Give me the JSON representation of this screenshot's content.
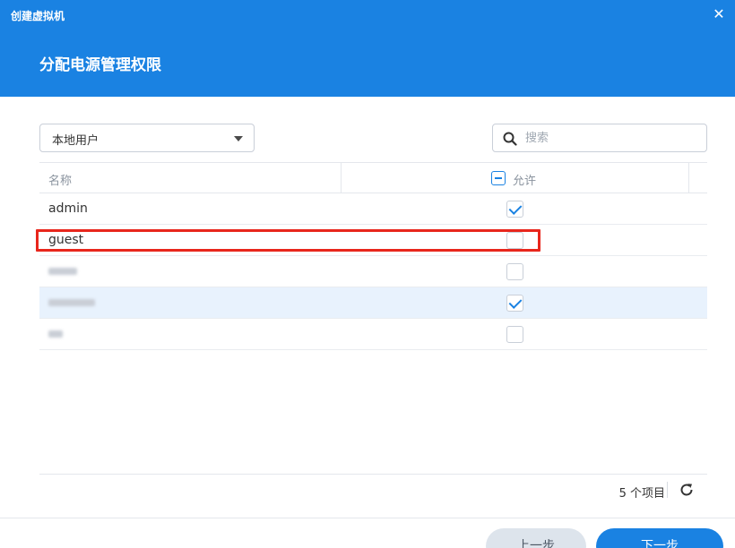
{
  "window": {
    "title": "创建虚拟机"
  },
  "page": {
    "title": "分配电源管理权限"
  },
  "filter": {
    "selected": "本地用户"
  },
  "search": {
    "placeholder": "搜索"
  },
  "table": {
    "columns": {
      "name": "名称",
      "allow": "允许"
    },
    "rows": [
      {
        "name": "admin",
        "allowed": true,
        "redacted": false
      },
      {
        "name": "guest",
        "allowed": false,
        "redacted": false,
        "highlighted": true
      },
      {
        "name": "",
        "allowed": false,
        "redacted": true
      },
      {
        "name": "",
        "allowed": true,
        "redacted": true,
        "selected": true
      },
      {
        "name": "",
        "allowed": false,
        "redacted": true
      }
    ]
  },
  "footer": {
    "count": "5 个项目"
  },
  "buttons": {
    "prev": "上一步",
    "next": "下一步"
  },
  "colors": {
    "accent": "#1a82e2",
    "highlight": "#e8261c",
    "selected_row": "#e8f2fd"
  },
  "icons": {
    "close": "close-icon",
    "dropdown": "chevron-down-icon",
    "search": "search-icon",
    "refresh": "refresh-icon"
  }
}
